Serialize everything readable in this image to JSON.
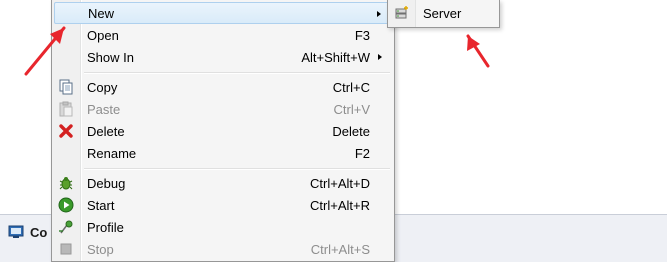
{
  "context_menu": {
    "items": [
      {
        "label": "New",
        "accel": "",
        "icon": "new-icon",
        "submenu": true,
        "disabled": false
      },
      {
        "label": "Open",
        "accel": "F3",
        "icon": "",
        "submenu": false,
        "disabled": false
      },
      {
        "label": "Show In",
        "accel": "Alt+Shift+W",
        "icon": "",
        "submenu": true,
        "disabled": false
      },
      {
        "label": "Copy",
        "accel": "Ctrl+C",
        "icon": "copy-icon",
        "submenu": false,
        "disabled": false
      },
      {
        "label": "Paste",
        "accel": "Ctrl+V",
        "icon": "paste-icon",
        "submenu": false,
        "disabled": true
      },
      {
        "label": "Delete",
        "accel": "Delete",
        "icon": "delete-icon",
        "submenu": false,
        "disabled": false
      },
      {
        "label": "Rename",
        "accel": "F2",
        "icon": "",
        "submenu": false,
        "disabled": false
      },
      {
        "label": "Debug",
        "accel": "Ctrl+Alt+D",
        "icon": "debug-icon",
        "submenu": false,
        "disabled": false
      },
      {
        "label": "Start",
        "accel": "Ctrl+Alt+R",
        "icon": "start-icon",
        "submenu": false,
        "disabled": false
      },
      {
        "label": "Profile",
        "accel": "",
        "icon": "profile-icon",
        "submenu": false,
        "disabled": false
      },
      {
        "label": "Stop",
        "accel": "Ctrl+Alt+S",
        "icon": "stop-icon",
        "submenu": false,
        "disabled": true
      }
    ]
  },
  "submenu": {
    "items": [
      {
        "label": "Server",
        "icon": "new-server-icon"
      }
    ]
  },
  "console_tab": {
    "label": "Co"
  },
  "colors": {
    "menu_bg": "#f5f5f5",
    "highlight": "#d9ebf9",
    "callout_arrow": "#e8262d",
    "disabled_text": "#8d8d8d"
  }
}
